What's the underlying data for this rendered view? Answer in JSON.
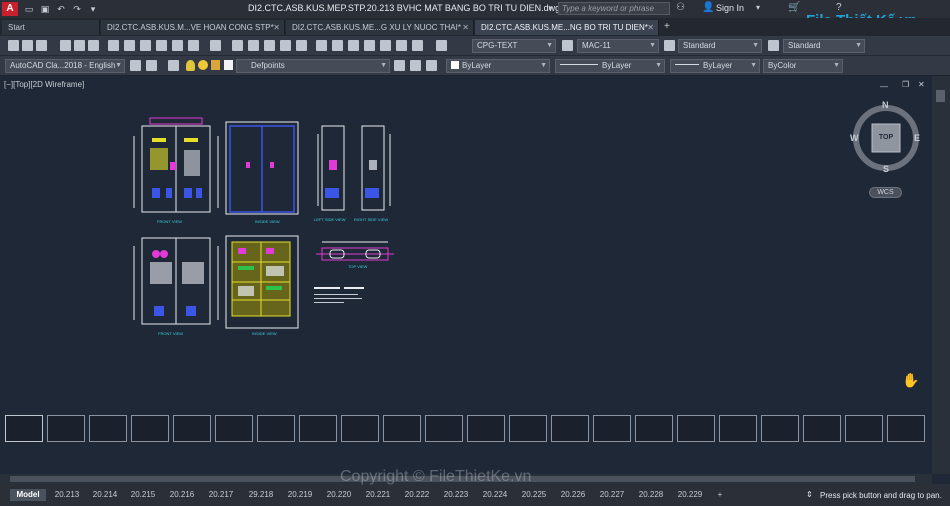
{
  "titlebar": {
    "logo": "A",
    "title": "DI2.CTC.ASB.KUS.MEP.STP.20.213 BVHC MAT BANG BO TRI TU DIEN.dwg",
    "search_placeholder": "Type a keyword or phrase",
    "sign_in": "Sign In"
  },
  "tabs": [
    {
      "label": "Start"
    },
    {
      "label": "DI2.CTC.ASB.KUS.M...VE HOAN CONG STP*"
    },
    {
      "label": "DI2.CTC.ASB.KUS.ME...G XU LY NUOC THAI*"
    },
    {
      "label": "DI2.CTC.ASB.KUS.ME...NG BO TRI TU DIEN*"
    }
  ],
  "toolbar": {
    "text_style": "CPG-TEXT",
    "dim_style": "MAC-11",
    "table_style": "Standard",
    "mleader_style": "Standard",
    "workspace": "AutoCAD Cla...2018 - English",
    "layer": "Defpoints",
    "color": "ByLayer",
    "linetype": "ByLayer",
    "lineweight": "ByLayer",
    "plotstyle": "ByColor"
  },
  "viewport": {
    "label": "[−][Top][2D Wireframe]",
    "cube_top": "TOP",
    "compass": {
      "n": "N",
      "s": "S",
      "e": "E",
      "w": "W"
    },
    "wcs": "WCS"
  },
  "drawing_captions": {
    "front_view": "FRONT VIEW",
    "inside_view": "INSIDE VIEW",
    "left_side_view": "LEFT SIDE VIEW",
    "right_side_view": "RIGHT SIDE VIEW",
    "top_view": "TOP VIEW"
  },
  "layout_tabs": [
    "Model",
    "20.213",
    "20.214",
    "20.215",
    "20.216",
    "20.217",
    "29.218",
    "20.219",
    "20.220",
    "20.221",
    "20.222",
    "20.223",
    "20.224",
    "20.225",
    "20.226",
    "20.227",
    "20.228",
    "20.229"
  ],
  "status": "Press pick button and drag to pan.",
  "watermark": {
    "brand": "File Thiết Kế.vn",
    "copyright": "Copyright © FileThietKe.vn"
  },
  "colors": {
    "canvas": "#1f2836",
    "drawing_white": "#e9ecf2",
    "drawing_blue": "#3b55e6",
    "drawing_magenta": "#e23ad6",
    "drawing_yellow": "#e6df2a",
    "caption_cyan": "#3ad2e6"
  }
}
